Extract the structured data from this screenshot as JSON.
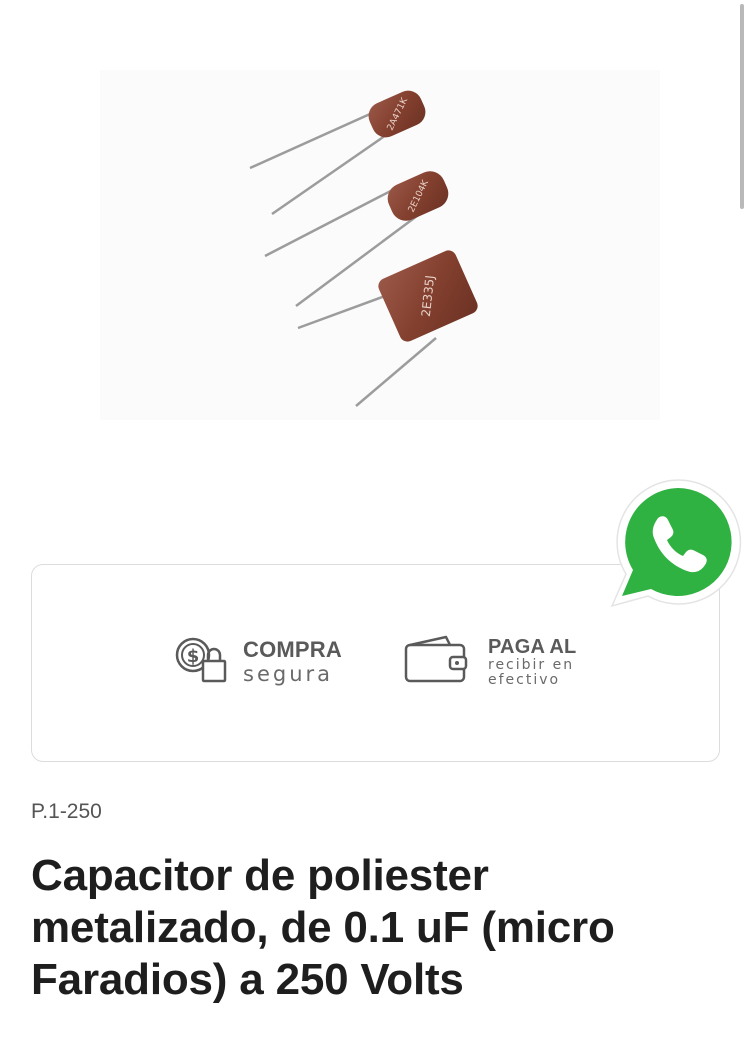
{
  "product": {
    "sku": "P.1-250",
    "title": "Capacitor de poliester metalizado, de 0.1 uF (micro Faradios) a 250 Volts",
    "capacitor_markings": [
      "2A471K",
      "2E104K",
      "2E335J"
    ]
  },
  "trust_badges": {
    "compra": {
      "title": "COMPRA",
      "subtitle": "segura",
      "icon": "coin-lock-icon"
    },
    "paga": {
      "title": "PAGA AL",
      "subtitle_line1": "recibir en",
      "subtitle_line2": "efectivo",
      "icon": "wallet-icon"
    }
  },
  "whatsapp": {
    "icon": "whatsapp-icon",
    "color": "#2fb242"
  },
  "colors": {
    "capacitor_body": "#8a4636",
    "text_dark": "#1e1e1e",
    "badge_text": "#5a5a5a"
  }
}
